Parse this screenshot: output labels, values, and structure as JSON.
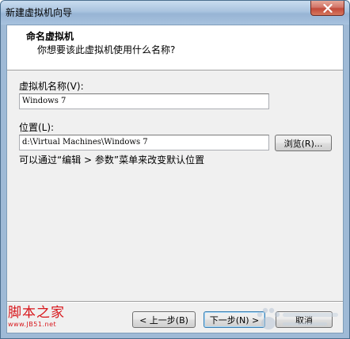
{
  "window": {
    "title": "新建虚拟机向导"
  },
  "header": {
    "title": "命名虚拟机",
    "subtitle": "你想要该此虚拟机使用什么名称?"
  },
  "form": {
    "name_label": "虚拟机名称(V):",
    "name_value": "Windows 7",
    "location_label": "位置(L):",
    "location_value": "d:\\Virtual Machines\\Windows 7",
    "browse_label": "浏览(R)...",
    "hint": "可以通过“编辑 > 参数”菜单来改变默认位置"
  },
  "footer": {
    "back_label": "< 上一步(B)",
    "next_label": "下一步(N) >",
    "cancel_label": "取消"
  },
  "watermark": {
    "site_name": "脚本之家",
    "site_url": "www.JB51.net"
  },
  "icons": {
    "close": "close-icon",
    "watermark_paw": "paw-icon"
  },
  "colors": {
    "titlebar": "#a9c3df",
    "close_button": "#c24a3a",
    "dialog_bg": "#f0f0f0",
    "watermark_red": "#d8161b"
  }
}
